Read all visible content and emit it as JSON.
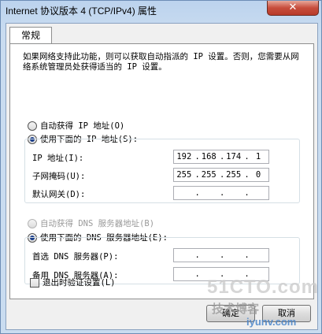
{
  "window": {
    "title": "Internet 协议版本 4 (TCP/IPv4) 属性",
    "close_label": "✕"
  },
  "tabs": [
    {
      "label": "常规"
    }
  ],
  "description": "如果网络支持此功能，则可以获取自动指派的 IP 设置。否则，您需要从网络系统管理员处获得适当的 IP 设置。",
  "ip_section": {
    "auto_label": "自动获得 IP 地址(O)",
    "manual_label": "使用下面的 IP 地址(S):",
    "selected": "manual",
    "fields": [
      {
        "label": "IP 地址(I):",
        "octets": [
          "192",
          "168",
          "174",
          "1"
        ]
      },
      {
        "label": "子网掩码(U):",
        "octets": [
          "255",
          "255",
          "255",
          "0"
        ]
      },
      {
        "label": "默认网关(D):",
        "octets": [
          "",
          "",
          "",
          ""
        ]
      }
    ]
  },
  "dns_section": {
    "auto_label": "自动获得 DNS 服务器地址(B)",
    "manual_label": "使用下面的 DNS 服务器地址(E):",
    "selected": "manual",
    "fields": [
      {
        "label": "首选 DNS 服务器(P):",
        "octets": [
          "",
          "",
          "",
          ""
        ]
      },
      {
        "label": "备用 DNS 服务器(A):",
        "octets": [
          "",
          "",
          "",
          ""
        ]
      }
    ]
  },
  "validate_checkbox": {
    "label": "退出时验证设置(L)",
    "checked": false
  },
  "buttons": {
    "ok": "确定",
    "cancel": "取消"
  },
  "watermark": {
    "line1": "51CTO.com",
    "line2": "技术博客",
    "line3": "iyunv.com"
  }
}
